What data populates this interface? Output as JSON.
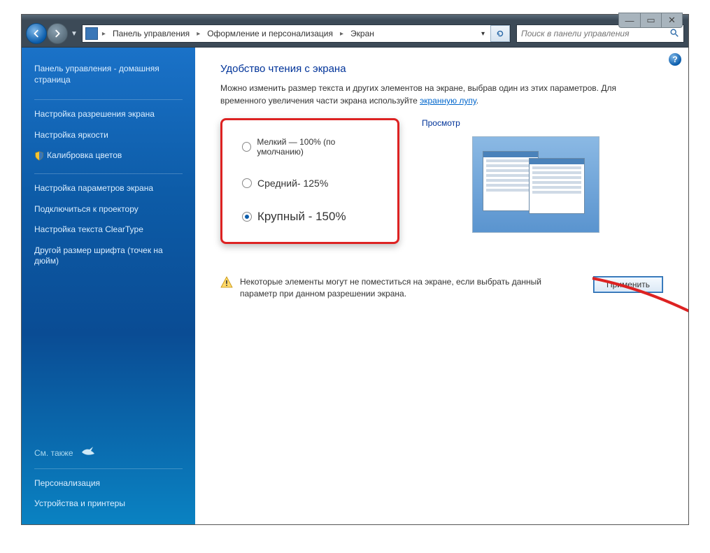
{
  "window_controls": {
    "minimize": "—",
    "maximize": "▭",
    "close": "✕"
  },
  "breadcrumb": {
    "items": [
      "Панель управления",
      "Оформление и персонализация",
      "Экран"
    ]
  },
  "search": {
    "placeholder": "Поиск в панели управления"
  },
  "sidebar": {
    "home": "Панель управления - домашняя страница",
    "items": [
      "Настройка разрешения экрана",
      "Настройка яркости",
      "Калибровка цветов",
      "Настройка параметров экрана",
      "Подключиться к проектору",
      "Настройка текста ClearType",
      "Другой размер шрифта (точек на дюйм)"
    ],
    "see_also_label": "См. также",
    "see_also_items": [
      "Персонализация",
      "Устройства и принтеры"
    ]
  },
  "content": {
    "title": "Удобство чтения с экрана",
    "desc_before": "Можно изменить размер текста и других элементов на экране, выбрав один из этих параметров. Для временного увеличения части экрана используйте ",
    "desc_link": "экранную лупу",
    "desc_after": ".",
    "options": {
      "small": "Мелкий — 100% (по умолчанию)",
      "medium": "Средний- 125%",
      "large": "Крупный - 150%",
      "selected": "large"
    },
    "preview_label": "Просмотр",
    "warning": "Некоторые элементы могут не поместиться на экране, если выбрать данный параметр при данном разрешении экрана.",
    "apply_button": "Применить"
  }
}
